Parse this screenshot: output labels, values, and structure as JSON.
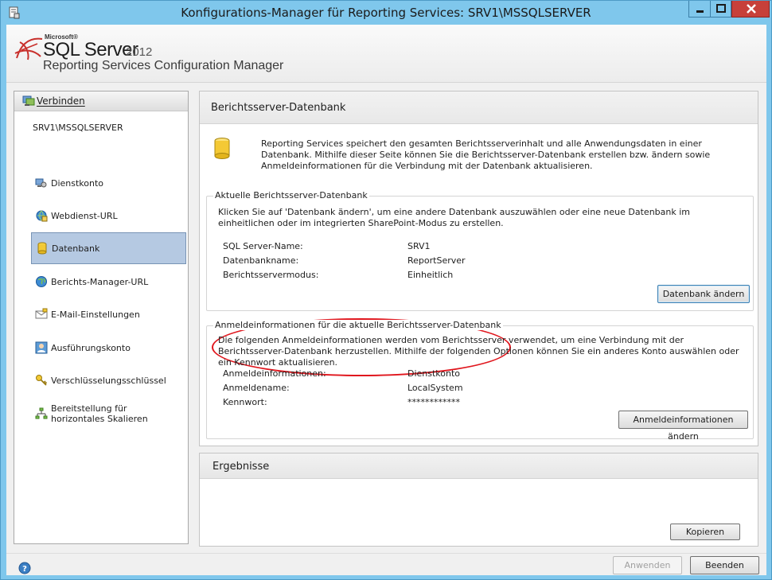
{
  "window": {
    "title": "Konfigurations-Manager für Reporting Services: SRV1\\MSSQLSERVER",
    "minimize_label": "",
    "maximize_label": "",
    "close_label": ""
  },
  "banner": {
    "vendor": "Microsoft®",
    "product": "SQL Server",
    "version": "2012",
    "subtitle": "Reporting Services Configuration Manager"
  },
  "sidebar": {
    "connect_label": "Verbinden",
    "server": "SRV1\\MSSQLSERVER",
    "items": [
      {
        "label": "Dienstkonto",
        "icon": "service-account-icon"
      },
      {
        "label": "Webdienst-URL",
        "icon": "web-service-icon"
      },
      {
        "label": "Datenbank",
        "icon": "database-icon",
        "selected": true
      },
      {
        "label": "Berichts-Manager-URL",
        "icon": "globe-icon"
      },
      {
        "label": "E-Mail-Einstellungen",
        "icon": "email-icon"
      },
      {
        "label": "Ausführungskonto",
        "icon": "execution-account-icon"
      },
      {
        "label": "Verschlüsselungsschlüssel",
        "icon": "key-icon"
      },
      {
        "label": "Bereitstellung für horizontales Skalieren",
        "icon": "scale-out-icon"
      }
    ]
  },
  "main": {
    "title": "Berichtsserver-Datenbank",
    "intro": "Reporting Services speichert den gesamten Berichtsserverinhalt und alle Anwendungsdaten in einer Datenbank. Mithilfe dieser Seite können Sie die Berichtsserver-Datenbank erstellen bzw. ändern sowie Anmeldeinformationen für die Verbindung mit der Datenbank aktualisieren.",
    "current_db": {
      "legend": "Aktuelle Berichtsserver-Datenbank",
      "description": "Klicken Sie auf 'Datenbank ändern', um eine andere Datenbank auszuwählen oder eine neue Datenbank im einheitlichen oder im integrierten SharePoint-Modus zu erstellen.",
      "fields": [
        {
          "key": "SQL Server-Name:",
          "value": "SRV1"
        },
        {
          "key": "Datenbankname:",
          "value": "ReportServer"
        },
        {
          "key": "Berichtsservermodus:",
          "value": "Einheitlich"
        }
      ],
      "button": "Datenbank ändern"
    },
    "credentials": {
      "legend": "Anmeldeinformationen für die aktuelle Berichtsserver-Datenbank",
      "description": "Die folgenden Anmeldeinformationen werden vom Berichtsserver verwendet, um eine Verbindung mit der Berichtsserver-Datenbank herzustellen. Mithilfe der folgenden Optionen können Sie ein anderes Konto auswählen oder ein Kennwort aktualisieren.",
      "fields": [
        {
          "key": "Anmeldeinformationen:",
          "value": "Dienstkonto"
        },
        {
          "key": "Anmeldename:",
          "value": "LocalSystem"
        },
        {
          "key": "Kennwort:",
          "value": "************"
        }
      ],
      "button": "Anmeldeinformationen ändern"
    }
  },
  "results": {
    "title": "Ergebnisse",
    "copy_button": "Kopieren"
  },
  "footer": {
    "apply_button": "Anwenden",
    "exit_button": "Beenden"
  },
  "colors": {
    "titlebar": "#7fc7ec",
    "close_button": "#c7403a",
    "selected_nav": "#b5c9e2",
    "highlight_annotation": "#e0161d"
  }
}
